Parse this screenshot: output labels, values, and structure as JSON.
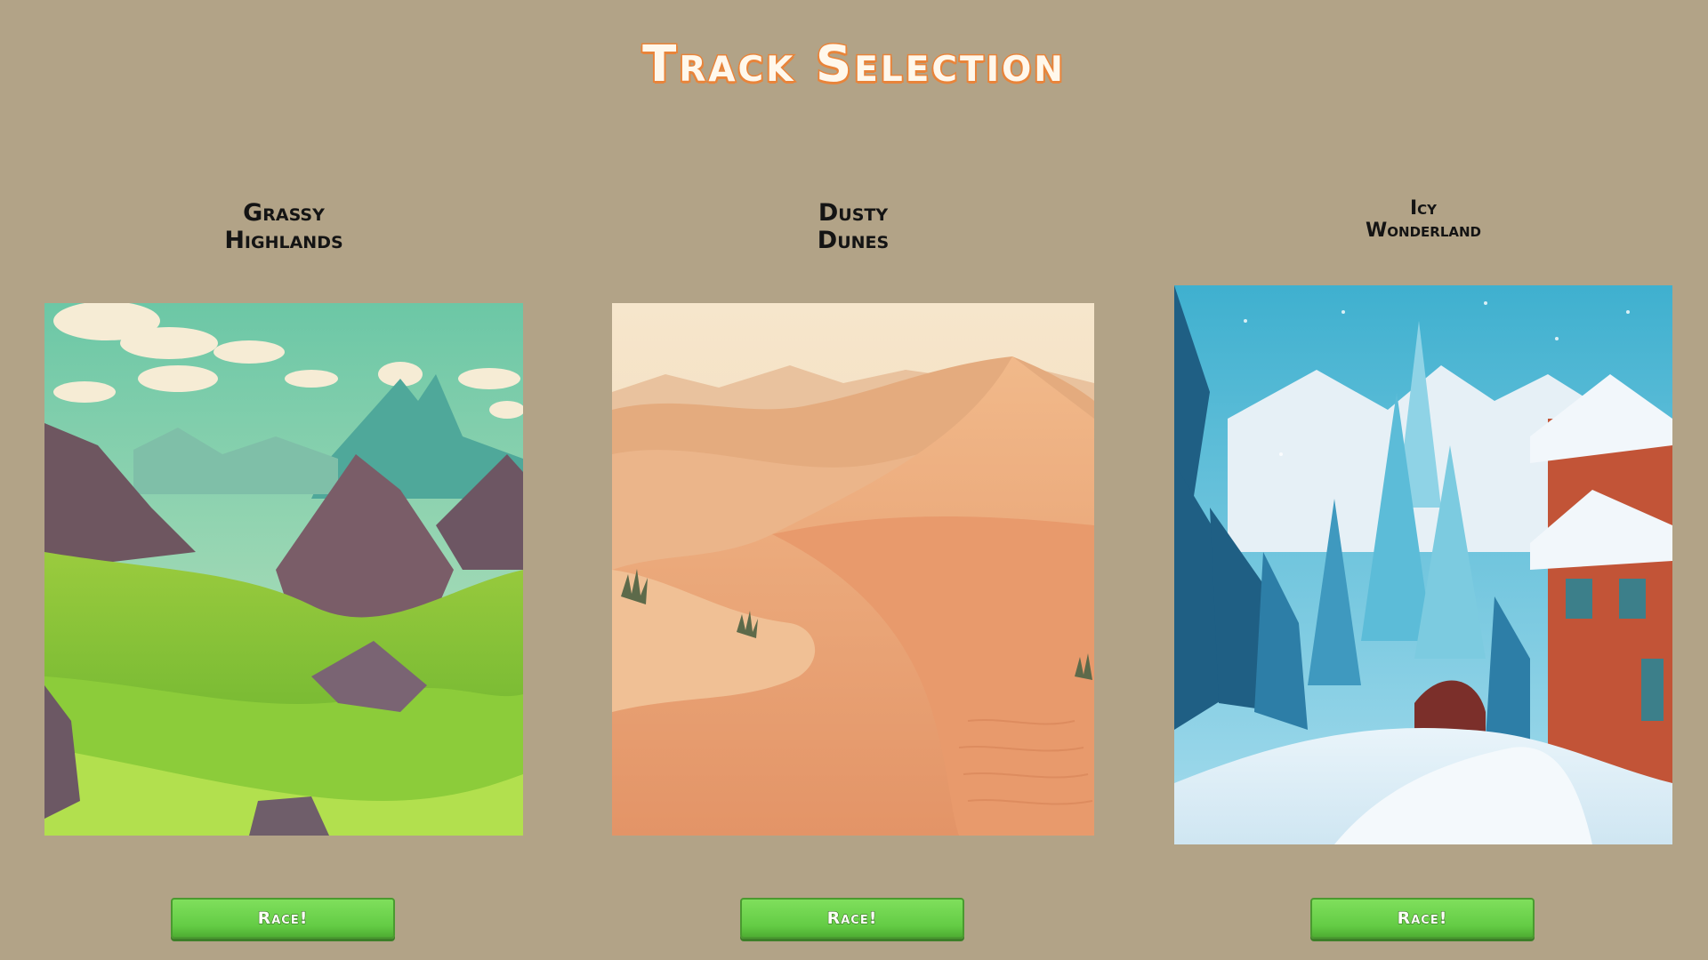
{
  "screen": {
    "title": "Track Selection"
  },
  "tracks": [
    {
      "name": "Grassy\nHighlands",
      "button_label": "Race!",
      "image": "grassy-highlands-landscape"
    },
    {
      "name": "Dusty\nDunes",
      "button_label": "Race!",
      "image": "dusty-dunes-landscape"
    },
    {
      "name": "Icy\nWonderland",
      "button_label": "Race!",
      "image": "icy-wonderland-landscape"
    }
  ],
  "colors": {
    "background": "#b2a387",
    "title_outline": "#e8843a",
    "button_green": "#6ad14b"
  }
}
